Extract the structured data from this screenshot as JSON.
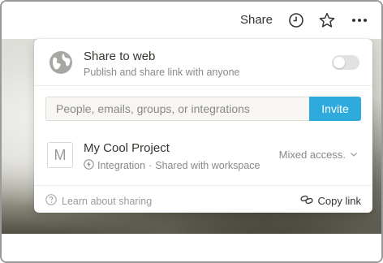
{
  "topbar": {
    "share_label": "Share",
    "icons": [
      "clock-icon",
      "star-icon",
      "more-icon"
    ]
  },
  "share_to_web": {
    "title": "Share to web",
    "subtitle": "Publish and share link with anyone",
    "enabled": false
  },
  "invite": {
    "placeholder": "People, emails, groups, or integrations",
    "value": "",
    "button_label": "Invite"
  },
  "member": {
    "avatar_letter": "M",
    "name": "My Cool Project",
    "type_label": "Integration",
    "separator": "·",
    "detail": "Shared with workspace",
    "access_label": "Mixed access."
  },
  "footer": {
    "learn_label": "Learn about sharing",
    "copy_label": "Copy link"
  },
  "colors": {
    "accent": "#2eaadc",
    "text": "#37352f",
    "muted": "#8a8985"
  }
}
